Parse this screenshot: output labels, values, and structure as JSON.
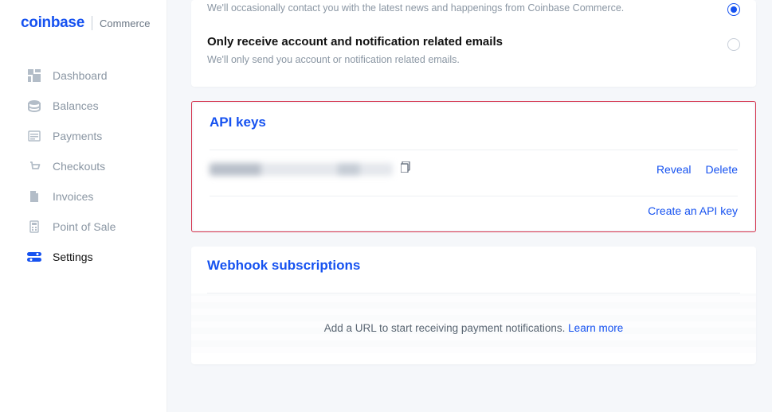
{
  "brand": {
    "primary": "coinbase",
    "secondary": "Commerce"
  },
  "nav": {
    "items": [
      {
        "label": "Dashboard"
      },
      {
        "label": "Balances"
      },
      {
        "label": "Payments"
      },
      {
        "label": "Checkouts"
      },
      {
        "label": "Invoices"
      },
      {
        "label": "Point of Sale"
      },
      {
        "label": "Settings"
      }
    ]
  },
  "emails": {
    "option_all_description": "We'll occasionally contact you with the latest news and happenings from Coinbase Commerce.",
    "option_only_title": "Only receive account and notification related emails",
    "option_only_description": "We'll only send you account or notification related emails."
  },
  "api": {
    "title": "API keys",
    "reveal": "Reveal",
    "delete": "Delete",
    "create": "Create an API key"
  },
  "webhook": {
    "title": "Webhook subscriptions",
    "empty_prefix": "Add a URL to start receiving payment notifications. ",
    "learn_more": "Learn more"
  }
}
